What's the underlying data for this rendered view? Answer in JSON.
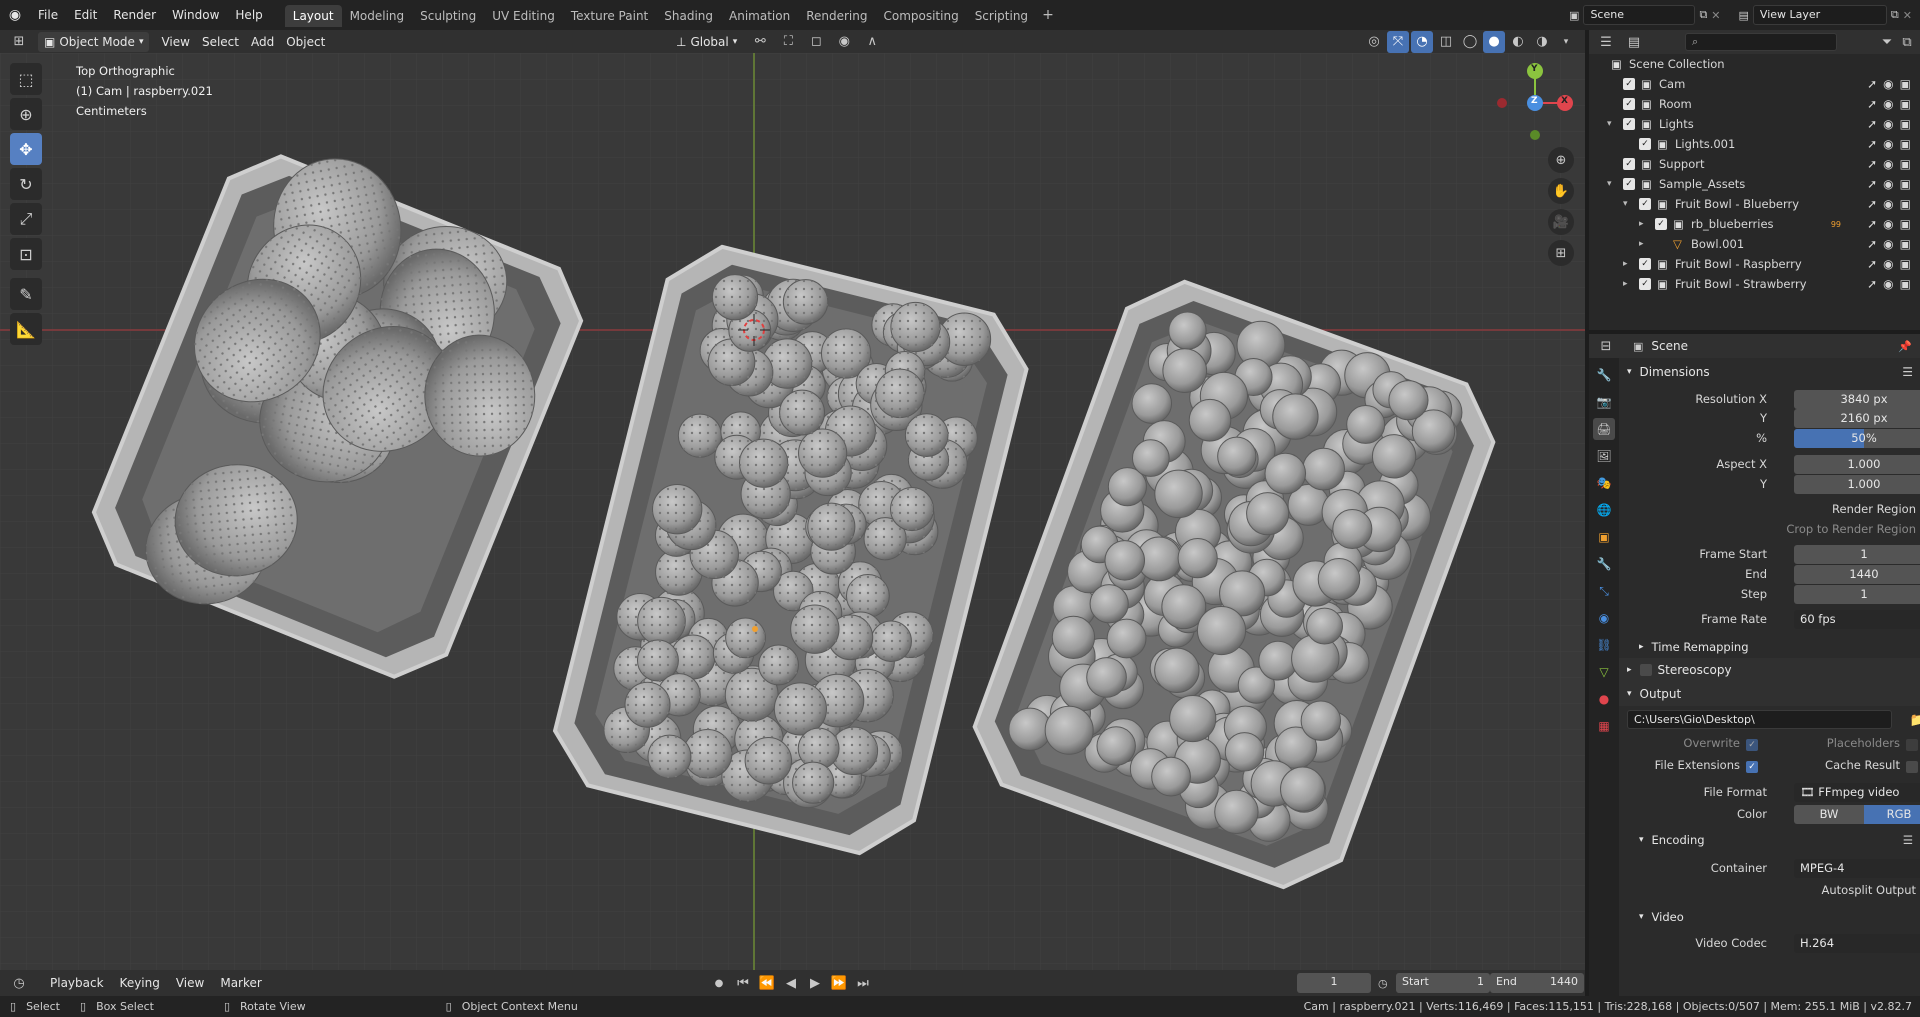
{
  "topbar": {
    "menus": [
      "File",
      "Edit",
      "Render",
      "Window",
      "Help"
    ],
    "workspaces": [
      "Layout",
      "Modeling",
      "Sculpting",
      "UV Editing",
      "Texture Paint",
      "Shading",
      "Animation",
      "Rendering",
      "Compositing",
      "Scripting"
    ],
    "active_workspace": "Layout",
    "add_tab": "+",
    "scene_name": "Scene",
    "view_layer": "View Layer"
  },
  "viewport_header": {
    "mode": "Object Mode",
    "menus": [
      "View",
      "Select",
      "Add",
      "Object"
    ],
    "orientation": "Global"
  },
  "viewport_info": {
    "line1": "Top Orthographic",
    "line2": "(1) Cam | raspberry.021",
    "line3": "Centimeters"
  },
  "gizmo": {
    "y": "Y",
    "z": "Z",
    "x": "X"
  },
  "outliner": {
    "search_placeholder": "",
    "rows": [
      {
        "label": "Scene Collection",
        "indent": 0,
        "icon": "collection-icon",
        "check": false
      },
      {
        "label": "Cam",
        "indent": 1,
        "icon": "collection-icon",
        "check": true
      },
      {
        "label": "Room",
        "indent": 1,
        "icon": "collection-icon",
        "check": true
      },
      {
        "label": "Lights",
        "indent": 1,
        "icon": "collection-icon",
        "check": true,
        "expand": "▾"
      },
      {
        "label": "Lights.001",
        "indent": 2,
        "icon": "collection-icon",
        "check": true
      },
      {
        "label": "Support",
        "indent": 1,
        "icon": "collection-icon",
        "check": true
      },
      {
        "label": "Sample_Assets",
        "indent": 1,
        "icon": "collection-icon",
        "check": true,
        "expand": "▾"
      },
      {
        "label": "Fruit Bowl - Blueberry",
        "indent": 2,
        "icon": "collection-icon",
        "check": true,
        "expand": "▾"
      },
      {
        "label": "rb_blueberries",
        "indent": 3,
        "icon": "collection-icon",
        "check": true,
        "expand": "▸",
        "badge": "99"
      },
      {
        "label": "Bowl.001",
        "indent": 3,
        "icon": "mesh-icon",
        "check": false,
        "expand": "▸"
      },
      {
        "label": "Fruit Bowl - Raspberry",
        "indent": 2,
        "icon": "collection-icon",
        "check": true,
        "expand": "▸"
      },
      {
        "label": "Fruit Bowl - Strawberry",
        "indent": 2,
        "icon": "collection-icon",
        "check": true,
        "expand": "▸"
      }
    ]
  },
  "properties": {
    "context_title": "Scene",
    "dimensions_label": "Dimensions",
    "resolution_x_label": "Resolution X",
    "resolution_x": "3840 px",
    "resolution_y_label": "Y",
    "resolution_y": "2160 px",
    "percent_label": "%",
    "percent": "50%",
    "percent_fraction": 0.5,
    "aspect_x_label": "Aspect X",
    "aspect_x": "1.000",
    "aspect_y_label": "Y",
    "aspect_y": "1.000",
    "render_region": "Render Region",
    "crop_region": "Crop to Render Region",
    "frame_start_label": "Frame Start",
    "frame_start": "1",
    "end_label": "End",
    "end": "1440",
    "step_label": "Step",
    "step": "1",
    "frame_rate_label": "Frame Rate",
    "frame_rate": "60 fps",
    "time_remapping": "Time Remapping",
    "stereoscopy": "Stereoscopy",
    "output_label": "Output",
    "output_path": "C:\\Users\\Gio\\Desktop\\",
    "overwrite": "Overwrite",
    "placeholders": "Placeholders",
    "file_extensions": "File Extensions",
    "cache_result": "Cache Result",
    "file_format_label": "File Format",
    "file_format": "FFmpeg video",
    "color_label": "Color",
    "color_bw": "BW",
    "color_rgb": "RGB",
    "encoding_label": "Encoding",
    "container_label": "Container",
    "container": "MPEG-4",
    "autosplit": "Autosplit Output",
    "video_label": "Video",
    "video_codec_label": "Video Codec",
    "video_codec": "H.264"
  },
  "timeline": {
    "menus": [
      "Playback",
      "Keying",
      "View",
      "Marker"
    ],
    "current_frame": "1",
    "start_label": "Start",
    "start": "1",
    "end_label": "End",
    "end": "1440"
  },
  "statusbar": {
    "select": "Select",
    "box_select": "Box Select",
    "rotate_view": "Rotate View",
    "context_menu": "Object Context Menu",
    "stats": "Cam | raspberry.021 | Verts:116,469 | Faces:115,151 | Tris:228,168 | Objects:0/507 | Mem: 255.1 MiB | v2.82.7"
  },
  "colors": {
    "accent": "#4772b3",
    "active_tool": "#5680c2",
    "x_axis": "#e0454d",
    "y_axis": "#8bc43f",
    "z_axis": "#4a8fe0"
  }
}
